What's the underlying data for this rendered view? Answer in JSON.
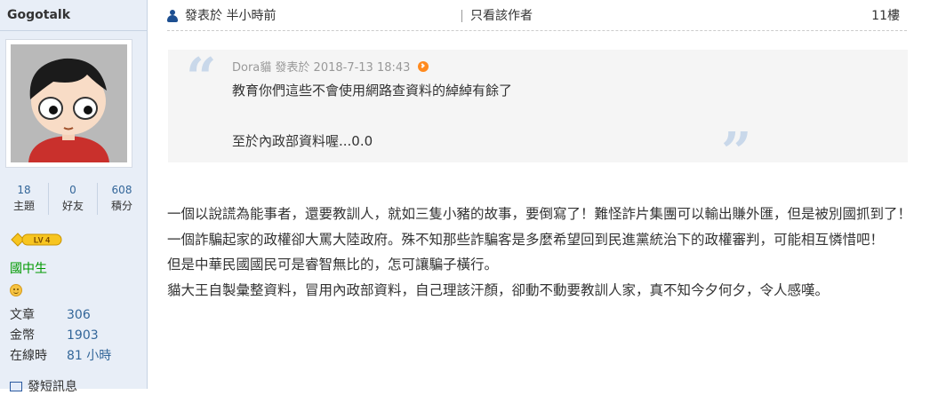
{
  "sidebar": {
    "username": "Gogotalk",
    "stats": [
      {
        "value": "18",
        "label": "主題"
      },
      {
        "value": "0",
        "label": "好友"
      },
      {
        "value": "608",
        "label": "積分"
      }
    ],
    "level_badge": "LV 4",
    "rank": "國中生",
    "info": [
      {
        "key": "文章",
        "value": "306"
      },
      {
        "key": "金幣",
        "value": "1903"
      },
      {
        "key": "在線時",
        "value": "81 小時"
      }
    ],
    "message_label": "發短訊息"
  },
  "post": {
    "posted_time": "發表於 半小時前",
    "author_only": "只看該作者",
    "floor": "11樓",
    "quote": {
      "author": "Dora貓",
      "posted": "發表於 2018-7-13 18:43",
      "line1": "教育你們這些不會使用網路查資料的綽綽有餘了",
      "line2": "至於內政部資料喔...0.0"
    },
    "body": [
      "一個以說謊為能事者，還要教訓人，就如三隻小豬的故事，要倒寫了！難怪詐片集團可以輸出賺外匯，但是被別國抓到了！一個詐騙起家的政權卻大罵大陸政府。殊不知那些詐騙客是多麼希望回到民進黨統治下的政權審判，可能相互憐惜吧！",
      "但是中華民國國民可是睿智無比的，怎可讓騙子橫行。",
      "貓大王自製彙整資料，冒用內政部資料，自己理該汗顏，卻動不動要教訓人家，真不知今夕何夕，令人感嘆。"
    ]
  },
  "colors": {
    "sidebar_bg": "#e8eef7",
    "link_blue": "#336699",
    "rank_green": "#009900",
    "quote_bg": "#f5f5f5",
    "quote_mark": "#c9d8ea"
  },
  "icons": [
    "user-icon",
    "jump-to-post-icon",
    "smile-icon",
    "message-icon",
    "quote-open-icon",
    "quote-close-icon"
  ]
}
